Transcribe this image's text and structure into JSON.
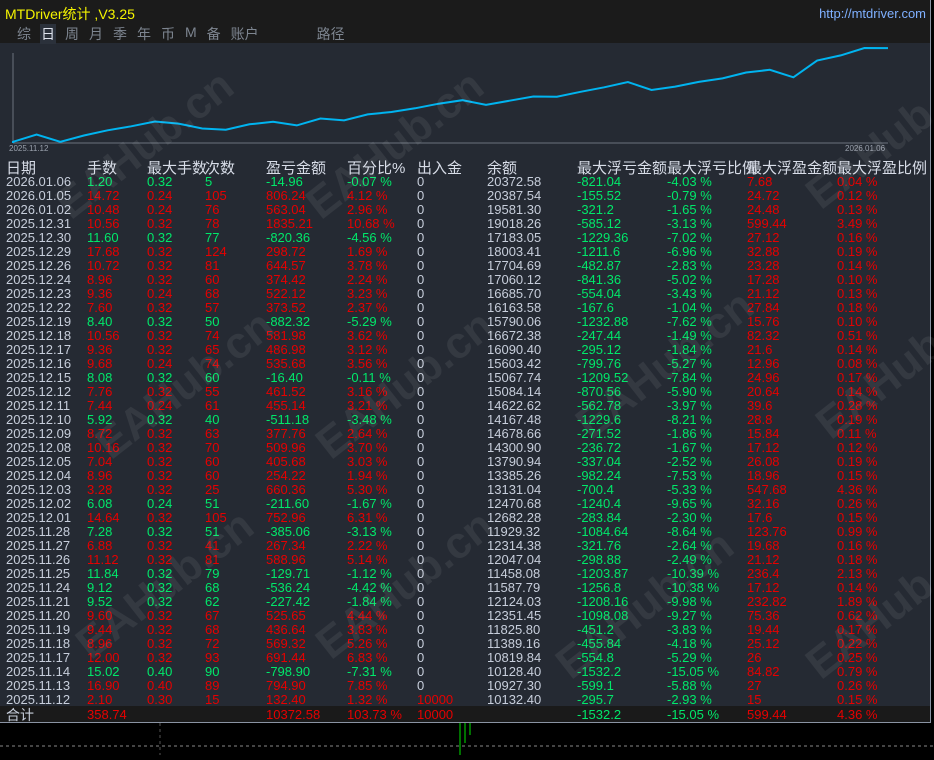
{
  "app": {
    "title": "MTDriver统计 ,V3.25",
    "url": "http://mtdriver.com"
  },
  "tabs": [
    {
      "label": "综",
      "active": false
    },
    {
      "label": "日",
      "active": true
    },
    {
      "label": "周",
      "active": false
    },
    {
      "label": "月",
      "active": false
    },
    {
      "label": "季",
      "active": false
    },
    {
      "label": "年",
      "active": false
    },
    {
      "label": "币",
      "active": false
    },
    {
      "label": "M",
      "active": false
    },
    {
      "label": "备",
      "active": false
    },
    {
      "label": "账户",
      "active": false
    },
    {
      "label": "路径",
      "active": false
    }
  ],
  "chart": {
    "start_date": "2025.11.12",
    "end_date": "2026.01.06",
    "line_color": "#00b4f0"
  },
  "colors": {
    "profit": "#e60000",
    "loss": "#00e86a",
    "neutral": "#c7cedb",
    "background": "#252a33"
  },
  "watermark": "EAHub.cn",
  "columns": [
    "日期",
    "手数",
    "最大手数",
    "次数",
    "盈亏金额",
    "百分比%",
    "出入金",
    "余额",
    "最大浮亏金额",
    "最大浮亏比例",
    "最大浮盈金额",
    "最大浮盈比例"
  ],
  "rows": [
    [
      "2026.01.06",
      "1.20",
      "0.32",
      "5",
      "-14.96",
      "-0.07 %",
      "0",
      "20372.58",
      "-821.04",
      "-4.03 %",
      "7.68",
      "0.04 %"
    ],
    [
      "2026.01.05",
      "14.72",
      "0.24",
      "105",
      "806.24",
      "4.12 %",
      "0",
      "20387.54",
      "-155.52",
      "-0.79 %",
      "24.72",
      "0.12 %"
    ],
    [
      "2026.01.02",
      "10.48",
      "0.24",
      "76",
      "563.04",
      "2.96 %",
      "0",
      "19581.30",
      "-321.2",
      "-1.65 %",
      "24.48",
      "0.13 %"
    ],
    [
      "2025.12.31",
      "10.56",
      "0.32",
      "78",
      "1835.21",
      "10.68 %",
      "0",
      "19018.26",
      "-585.12",
      "-3.13 %",
      "599.44",
      "3.49 %"
    ],
    [
      "2025.12.30",
      "11.60",
      "0.32",
      "77",
      "-820.36",
      "-4.56 %",
      "0",
      "17183.05",
      "-1229.36",
      "-7.02 %",
      "27.12",
      "0.16 %"
    ],
    [
      "2025.12.29",
      "17.68",
      "0.32",
      "124",
      "298.72",
      "1.69 %",
      "0",
      "18003.41",
      "-1211.6",
      "-6.96 %",
      "32.88",
      "0.19 %"
    ],
    [
      "2025.12.26",
      "10.72",
      "0.32",
      "81",
      "644.57",
      "3.78 %",
      "0",
      "17704.69",
      "-482.87",
      "-2.83 %",
      "23.28",
      "0.14 %"
    ],
    [
      "2025.12.24",
      "8.96",
      "0.32",
      "60",
      "374.42",
      "2.24 %",
      "0",
      "17060.12",
      "-841.36",
      "-5.02 %",
      "17.28",
      "0.10 %"
    ],
    [
      "2025.12.23",
      "9.36",
      "0.24",
      "68",
      "522.12",
      "3.23 %",
      "0",
      "16685.70",
      "-554.04",
      "-3.43 %",
      "21.12",
      "0.13 %"
    ],
    [
      "2025.12.22",
      "7.60",
      "0.32",
      "57",
      "373.52",
      "2.37 %",
      "0",
      "16163.58",
      "-167.6",
      "-1.04 %",
      "27.84",
      "0.18 %"
    ],
    [
      "2025.12.19",
      "8.40",
      "0.32",
      "50",
      "-882.32",
      "-5.29 %",
      "0",
      "15790.06",
      "-1232.88",
      "-7.62 %",
      "15.76",
      "0.10 %"
    ],
    [
      "2025.12.18",
      "10.56",
      "0.32",
      "74",
      "581.98",
      "3.62 %",
      "0",
      "16672.38",
      "-247.44",
      "-1.49 %",
      "82.32",
      "0.51 %"
    ],
    [
      "2025.12.17",
      "9.36",
      "0.32",
      "65",
      "486.98",
      "3.12 %",
      "0",
      "16090.40",
      "-295.12",
      "-1.84 %",
      "21.6",
      "0.14 %"
    ],
    [
      "2025.12.16",
      "9.68",
      "0.24",
      "74",
      "535.68",
      "3.56 %",
      "0",
      "15603.42",
      "-799.76",
      "-5.27 %",
      "12.96",
      "0.08 %"
    ],
    [
      "2025.12.15",
      "8.08",
      "0.32",
      "60",
      "-16.40",
      "-0.11 %",
      "0",
      "15067.74",
      "-1209.52",
      "-7.84 %",
      "24.96",
      "0.17 %"
    ],
    [
      "2025.12.12",
      "7.76",
      "0.32",
      "55",
      "461.52",
      "3.16 %",
      "0",
      "15084.14",
      "-870.56",
      "-5.90 %",
      "20.64",
      "0.14 %"
    ],
    [
      "2025.12.11",
      "7.44",
      "0.24",
      "61",
      "455.14",
      "3.21 %",
      "0",
      "14622.62",
      "-562.78",
      "-3.97 %",
      "39.6",
      "0.28 %"
    ],
    [
      "2025.12.10",
      "5.92",
      "0.32",
      "40",
      "-511.18",
      "-3.48 %",
      "0",
      "14167.48",
      "-1229.6",
      "-8.21 %",
      "28.8",
      "0.19 %"
    ],
    [
      "2025.12.09",
      "8.72",
      "0.32",
      "63",
      "377.76",
      "2.64 %",
      "0",
      "14678.66",
      "-271.52",
      "-1.86 %",
      "15.84",
      "0.11 %"
    ],
    [
      "2025.12.08",
      "10.16",
      "0.32",
      "70",
      "509.96",
      "3.70 %",
      "0",
      "14300.90",
      "-236.72",
      "-1.67 %",
      "17.12",
      "0.12 %"
    ],
    [
      "2025.12.05",
      "7.04",
      "0.32",
      "60",
      "405.68",
      "3.03 %",
      "0",
      "13790.94",
      "-337.04",
      "-2.52 %",
      "26.08",
      "0.19 %"
    ],
    [
      "2025.12.04",
      "8.96",
      "0.32",
      "60",
      "254.22",
      "1.94 %",
      "0",
      "13385.26",
      "-982.24",
      "-7.53 %",
      "18.96",
      "0.15 %"
    ],
    [
      "2025.12.03",
      "3.28",
      "0.32",
      "25",
      "660.36",
      "5.30 %",
      "0",
      "13131.04",
      "-700.4",
      "-5.33 %",
      "547.68",
      "4.36 %"
    ],
    [
      "2025.12.02",
      "6.08",
      "0.24",
      "51",
      "-211.60",
      "-1.67 %",
      "0",
      "12470.68",
      "-1240.4",
      "-9.65 %",
      "32.16",
      "0.26 %"
    ],
    [
      "2025.12.01",
      "14.64",
      "0.32",
      "105",
      "752.96",
      "6.31 %",
      "0",
      "12682.28",
      "-283.84",
      "-2.30 %",
      "17.6",
      "0.15 %"
    ],
    [
      "2025.11.28",
      "7.28",
      "0.32",
      "51",
      "-385.06",
      "-3.13 %",
      "0",
      "11929.32",
      "-1084.64",
      "-8.64 %",
      "123.76",
      "0.99 %"
    ],
    [
      "2025.11.27",
      "6.88",
      "0.32",
      "41",
      "267.34",
      "2.22 %",
      "0",
      "12314.38",
      "-321.76",
      "-2.64 %",
      "19.68",
      "0.16 %"
    ],
    [
      "2025.11.26",
      "11.12",
      "0.32",
      "81",
      "588.96",
      "5.14 %",
      "0",
      "12047.04",
      "-298.88",
      "-2.49 %",
      "21.12",
      "0.18 %"
    ],
    [
      "2025.11.25",
      "11.84",
      "0.32",
      "79",
      "-129.71",
      "-1.12 %",
      "0",
      "11458.08",
      "-1203.87",
      "-10.39 %",
      "236.4",
      "2.13 %"
    ],
    [
      "2025.11.24",
      "9.12",
      "0.32",
      "68",
      "-536.24",
      "-4.42 %",
      "0",
      "11587.79",
      "-1256.8",
      "-10.38 %",
      "17.12",
      "0.14 %"
    ],
    [
      "2025.11.21",
      "9.52",
      "0.32",
      "62",
      "-227.42",
      "-1.84 %",
      "0",
      "12124.03",
      "-1208.16",
      "-9.98 %",
      "232.82",
      "1.89 %"
    ],
    [
      "2025.11.20",
      "9.60",
      "0.32",
      "67",
      "525.65",
      "4.44 %",
      "0",
      "12351.45",
      "-1098.08",
      "-9.27 %",
      "75.36",
      "0.62 %"
    ],
    [
      "2025.11.19",
      "9.44",
      "0.32",
      "68",
      "436.64",
      "3.83 %",
      "0",
      "11825.80",
      "-451.2",
      "-3.83 %",
      "19.44",
      "0.17 %"
    ],
    [
      "2025.11.18",
      "8.96",
      "0.32",
      "72",
      "569.32",
      "5.26 %",
      "0",
      "11389.16",
      "-455.84",
      "-4.18 %",
      "25.12",
      "0.22 %"
    ],
    [
      "2025.11.17",
      "12.00",
      "0.32",
      "93",
      "691.44",
      "6.83 %",
      "0",
      "10819.84",
      "-554.8",
      "-5.29 %",
      "26",
      "0.25 %"
    ],
    [
      "2025.11.14",
      "15.02",
      "0.40",
      "90",
      "-798.90",
      "-7.31 %",
      "0",
      "10128.40",
      "-1532.2",
      "-15.05 %",
      "84.82",
      "0.79 %"
    ],
    [
      "2025.11.13",
      "16.90",
      "0.40",
      "89",
      "794.90",
      "7.85 %",
      "0",
      "10927.30",
      "-599.1",
      "-5.88 %",
      "27",
      "0.26 %"
    ],
    [
      "2025.11.12",
      "2.10",
      "0.30",
      "15",
      "132.40",
      "1.32 %",
      "10000",
      "10132.40",
      "-295.7",
      "-2.93 %",
      "15",
      "0.15 %"
    ]
  ],
  "total": {
    "label": "合计",
    "values": [
      "358.74",
      "",
      "",
      "10372.58",
      "103.73 %",
      "10000",
      "",
      "-1532.2",
      "-15.05 %",
      "599.44",
      "4.36 %"
    ]
  }
}
